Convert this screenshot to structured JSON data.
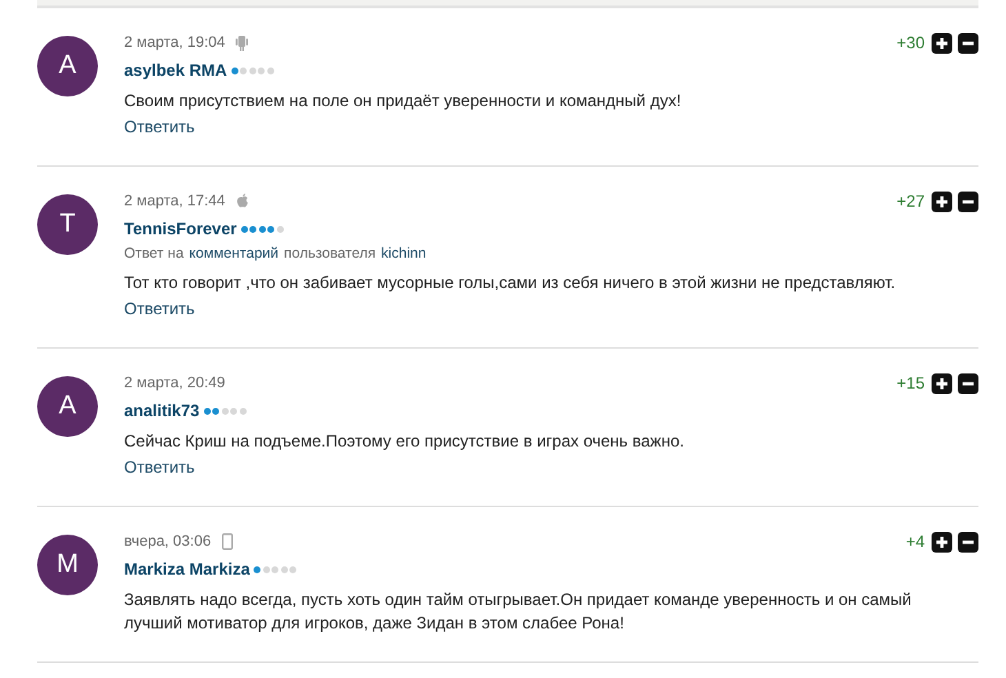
{
  "comments": [
    {
      "initial": "A",
      "date": "2 марта, 19:04",
      "device": {
        "kind": "android"
      },
      "author": "asylbek RMA",
      "stars": 1,
      "text": "Своим присутствием на поле он придаёт уверенности и командный дух!",
      "reply": "Ответить",
      "score": "+30"
    },
    {
      "initial": "T",
      "date": "2 марта, 17:44",
      "device": {
        "kind": "apple"
      },
      "author": "TennisForever",
      "stars": 4,
      "reply_to": {
        "prefix": "Ответ на",
        "link": "комментарий",
        "middle": "пользователя",
        "user": "kichinn"
      },
      "text": "Тот кто говорит ,что он забивает мусорные голы,сами из себя ничего в этой жизни не представляют.",
      "reply": "Ответить",
      "score": "+27"
    },
    {
      "initial": "A",
      "date": "2 марта, 20:49",
      "author": "analitik73",
      "stars": 2,
      "text": "Сейчас Криш на подъеме.Поэтому его присутствие в играх очень важно.",
      "reply": "Ответить",
      "score": "+15"
    },
    {
      "initial": "M",
      "date": "вчера, 03:06",
      "device": {
        "kind": "phone"
      },
      "author": "Markiza Markiza",
      "stars": 1,
      "text": "Заявлять надо всегда, пусть хоть один тайм отыгрывает.Он придает команде уверенность и он самый лучший мотиватор для игроков, даже Зидан в этом слабее Рона!",
      "score": "+4"
    }
  ]
}
